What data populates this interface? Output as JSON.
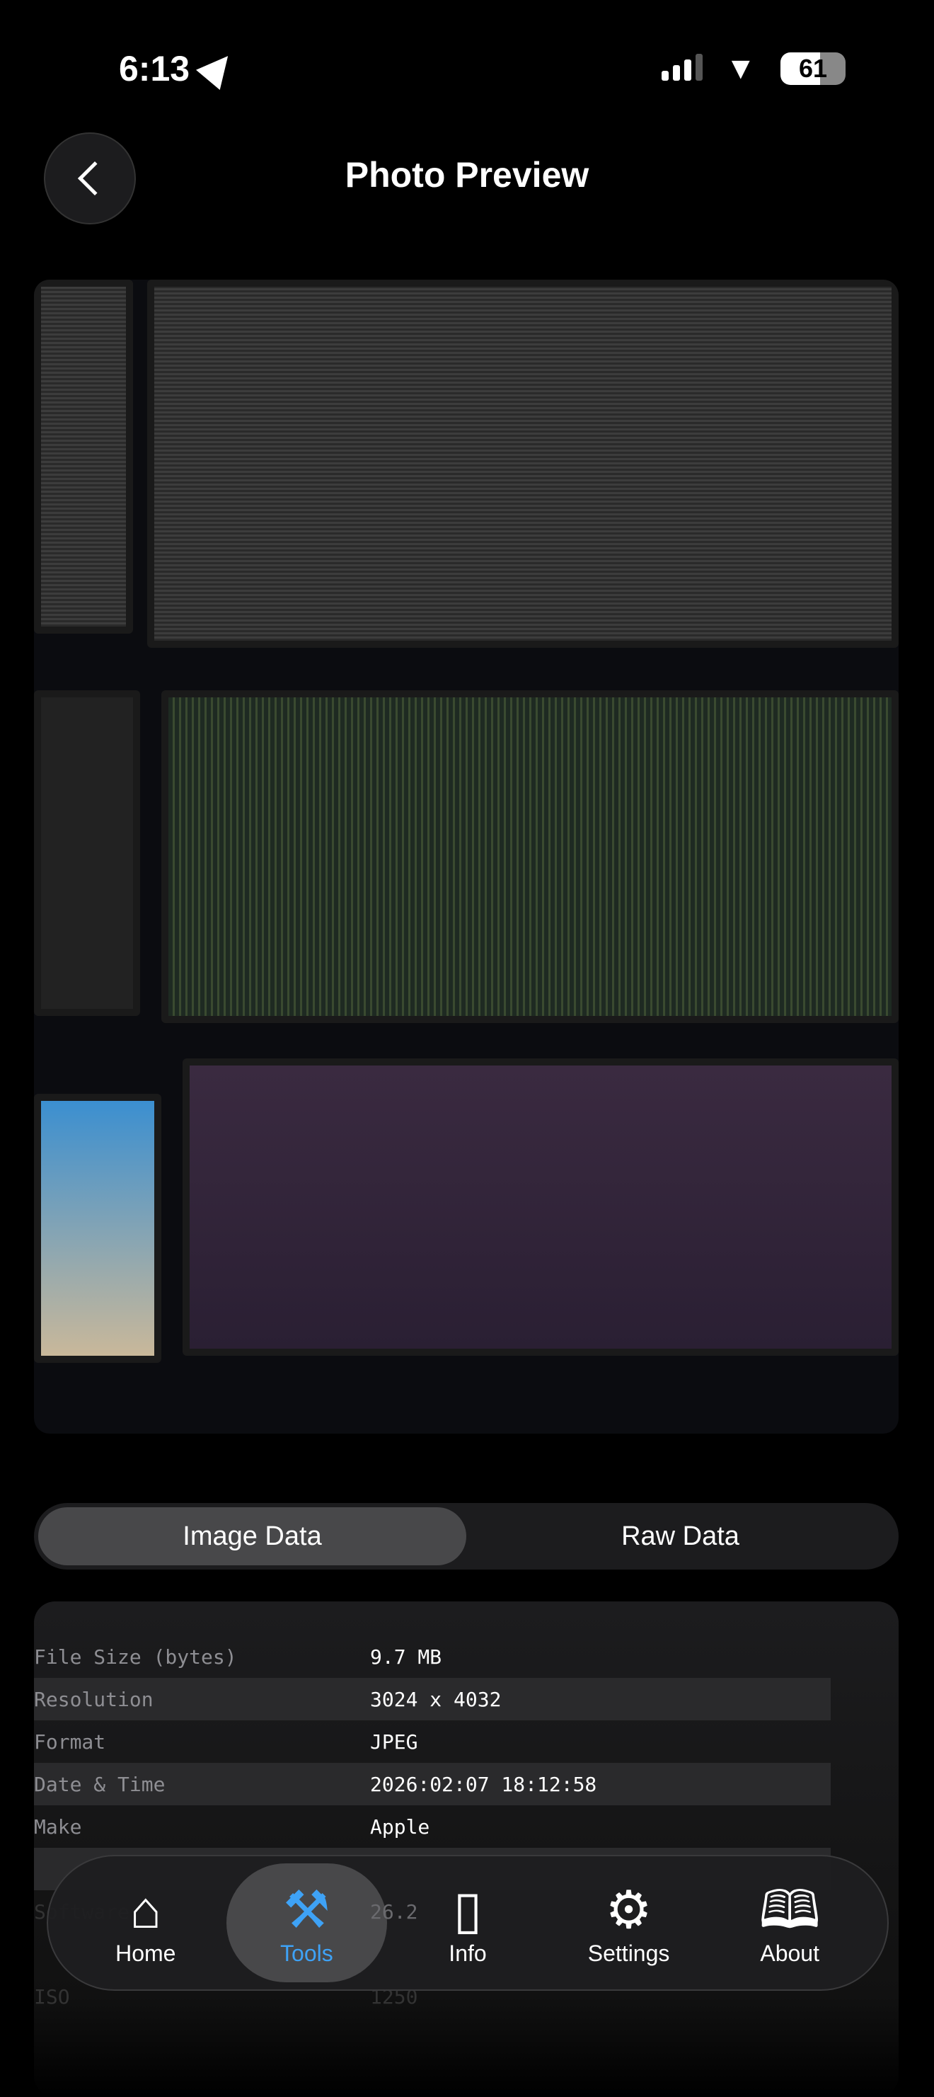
{
  "status_bar": {
    "time": "6:13",
    "battery": "61",
    "battery_level_percent": 61
  },
  "header": {
    "title": "Photo Preview",
    "back_icon": "chevron-left-icon"
  },
  "segments": [
    {
      "label": "Image Data",
      "selected": true
    },
    {
      "label": "Raw Data",
      "selected": false
    }
  ],
  "metadata": [
    {
      "key": "File Size (bytes)",
      "value": "9.7 MB"
    },
    {
      "key": "Resolution",
      "value": "3024 x 4032"
    },
    {
      "key": "Format",
      "value": "JPEG"
    },
    {
      "key": "Date & Time",
      "value": "2026:02:07 18:12:58"
    },
    {
      "key": "Make",
      "value": "Apple"
    },
    {
      "key": "Software",
      "value": "26.2"
    },
    {
      "key": "ISO",
      "value": "1250"
    }
  ],
  "nav": [
    {
      "label": "Home",
      "icon": "house-icon"
    },
    {
      "label": "Tools",
      "icon": "tools-icon",
      "active": true
    },
    {
      "label": "Info",
      "icon": "phone-icon"
    },
    {
      "label": "Settings",
      "icon": "gear-icon"
    },
    {
      "label": "About",
      "icon": "book-icon"
    }
  ],
  "colors": {
    "accent": "#3ea2f6",
    "background": "#000000",
    "card": "#1c1c1e"
  }
}
